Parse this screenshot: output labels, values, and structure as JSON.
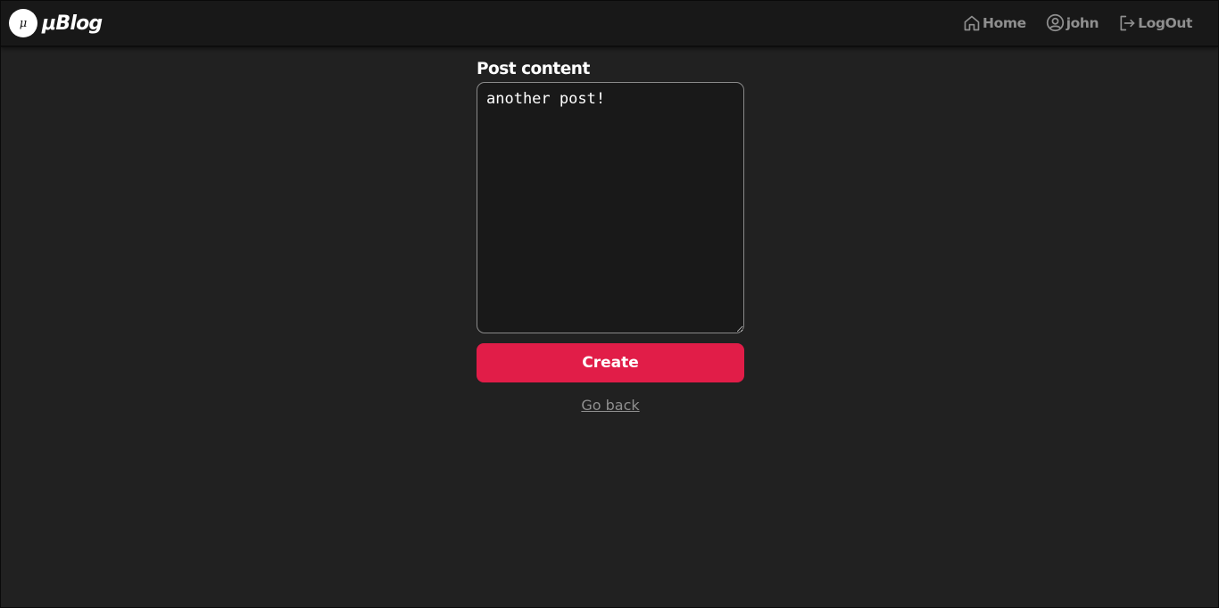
{
  "navbar": {
    "logo_glyph": "μ",
    "brand": "μBlog",
    "links": [
      {
        "label": "Home",
        "icon": "home-icon"
      },
      {
        "label": "john",
        "icon": "user-circle-icon"
      },
      {
        "label": "LogOut",
        "icon": "logout-icon"
      }
    ]
  },
  "form": {
    "label": "Post content",
    "content": "another post!",
    "submit_label": "Create",
    "back_link": "Go back"
  },
  "colors": {
    "background": "#212121",
    "navbar": "#181818",
    "accent": "#e11d48",
    "muted_text": "#8f8f8f"
  }
}
